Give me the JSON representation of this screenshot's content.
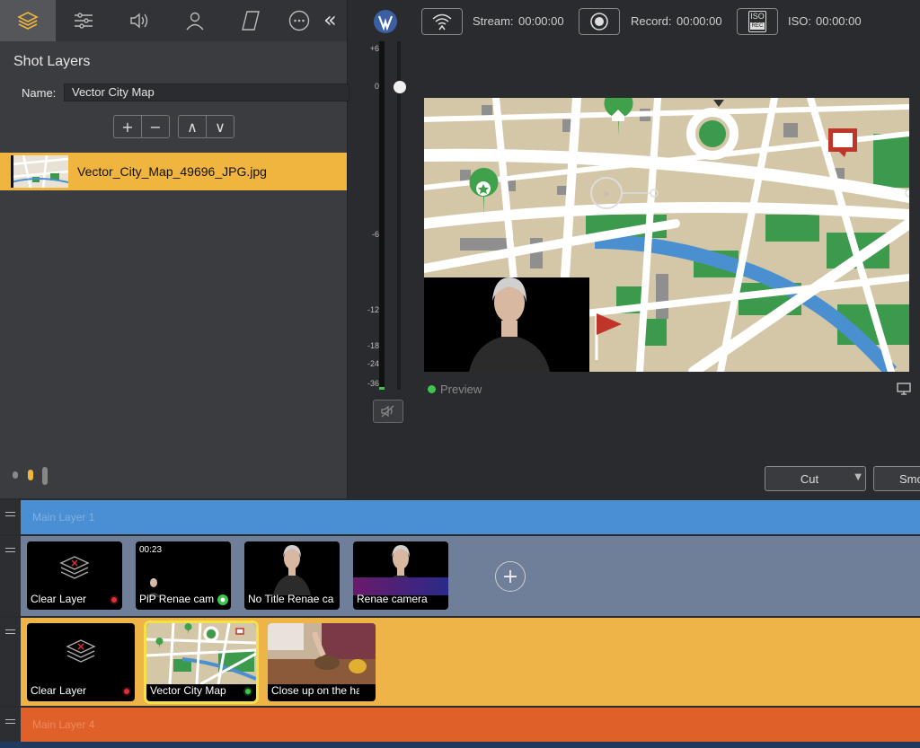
{
  "left_tabs": [
    "shot-layers-icon",
    "sliders-icon",
    "speaker-icon",
    "person-icon",
    "parallelogram-icon",
    "more-icon"
  ],
  "shot_layers": {
    "title": "Shot Layers",
    "name_label": "Name:",
    "name_value": "Vector City Map",
    "buttons": {
      "add": "+",
      "remove": "−",
      "up": "∧",
      "down": "∨"
    },
    "layer_file": "Vector_City_Map_49696_JPG.jpg"
  },
  "toolbar": {
    "stream_label": "Stream:",
    "stream_time": "00:00:00",
    "record_label": "Record:",
    "record_time": "00:00:00",
    "iso_label": "ISO:",
    "iso_time": "00:00:00",
    "iso_badge_top": "ISO",
    "iso_badge_bottom": "REC"
  },
  "meter_ticks": [
    "+6",
    "0",
    "-6",
    "-12",
    "-18",
    "-24",
    "-36"
  ],
  "preview": {
    "label": "Preview"
  },
  "transition": {
    "cut_label": "Cut",
    "smooth_label": "Smo"
  },
  "layers": {
    "main_layer_1": "Main Layer 1",
    "main_layer_4": "Main Layer 4",
    "row1_cards": [
      {
        "caption": "Clear Layer"
      },
      {
        "caption": "PiP Renae cam",
        "time": "00:23"
      },
      {
        "caption": "No Title Renae ca"
      },
      {
        "caption": "Renae camera"
      }
    ],
    "row2_cards": [
      {
        "caption": "Clear Layer"
      },
      {
        "caption": "Vector City Map"
      },
      {
        "caption": "Close up on the har"
      }
    ]
  },
  "colors": {
    "accent_yellow": "#f0b53f",
    "band_blue": "#4a8fd3",
    "band_slate": "#6f7f99",
    "band_yellow": "#eeb447",
    "band_orange": "#e0602a",
    "live_green": "#3fc44f"
  }
}
